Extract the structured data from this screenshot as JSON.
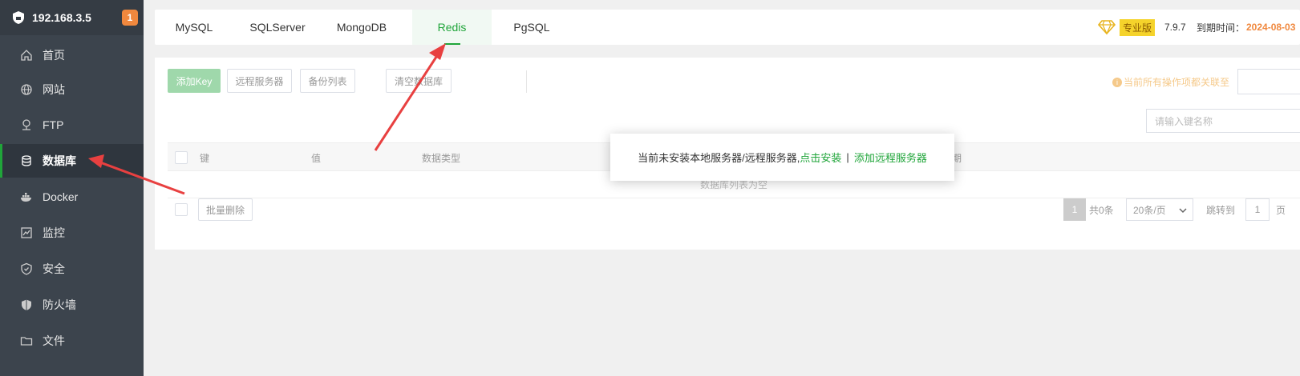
{
  "sidebar": {
    "server_ip": "192.168.3.5",
    "badge_count": "1",
    "items": [
      {
        "label": "首页",
        "icon": "home-icon"
      },
      {
        "label": "网站",
        "icon": "globe-icon"
      },
      {
        "label": "FTP",
        "icon": "ftp-icon"
      },
      {
        "label": "数据库",
        "icon": "database-icon"
      },
      {
        "label": "Docker",
        "icon": "docker-icon"
      },
      {
        "label": "监控",
        "icon": "monitor-icon"
      },
      {
        "label": "安全",
        "icon": "shield-check-icon"
      },
      {
        "label": "防火墙",
        "icon": "firewall-icon"
      },
      {
        "label": "文件",
        "icon": "folder-icon"
      }
    ],
    "active_item": "数据库"
  },
  "tabs": {
    "items": [
      "MySQL",
      "SQLServer",
      "MongoDB",
      "Redis",
      "PgSQL"
    ],
    "active": "Redis"
  },
  "header": {
    "edition_label": "专业版",
    "version": "7.9.7",
    "expire_label": "到期时间：",
    "expire_date": "2024-08-03"
  },
  "toolbar": {
    "add_key": "添加Key",
    "remote_servers": "远程服务器",
    "backup_list": "备份列表",
    "clear_db": "清空数据库",
    "notice": "当前所有操作项都关联至",
    "search_placeholder": "请输入键名称"
  },
  "table": {
    "columns": [
      "键",
      "值",
      "数据类型",
      "有效期"
    ],
    "empty_text": "数据库列表为空"
  },
  "footer": {
    "batch_delete": "批量删除",
    "current_page": "1",
    "total": "共0条",
    "page_size": "20条/页",
    "jump_label": "跳转到",
    "jump_value": "1",
    "page_label": "页"
  },
  "modal": {
    "message": "当前未安装本地服务器/远程服务器,",
    "install_link": "点击安装",
    "separator": "|",
    "add_remote_link": "添加远程服务器"
  },
  "colors": {
    "brand_green": "#20a53a",
    "sidebar_bg": "#3c444d",
    "arrow_red": "#e84040",
    "warn_orange": "#f0883e"
  }
}
